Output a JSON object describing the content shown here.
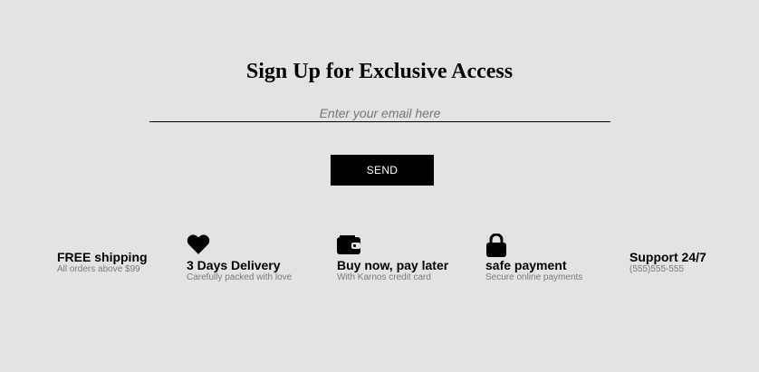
{
  "signup": {
    "heading": "Sign Up for Exclusive Access",
    "email_placeholder": "Enter your email here",
    "send_label": "SEND"
  },
  "features": [
    {
      "title": "FREE shipping",
      "subtitle": "All orders above $99",
      "icon": ""
    },
    {
      "title": "3 Days Delivery",
      "subtitle": "Carefully packed with love",
      "icon": "heart-icon"
    },
    {
      "title": "Buy now, pay later",
      "subtitle": "With Karnos credit card",
      "icon": "wallet-icon"
    },
    {
      "title": "safe payment",
      "subtitle": "Secure online payments",
      "icon": "lock-icon"
    },
    {
      "title": "Support 24/7",
      "subtitle": "(555)555-555",
      "icon": ""
    }
  ],
  "colors": {
    "background": "#e3e3e3",
    "button": "#000000",
    "button_text": "#ffffff",
    "subtitle": "#7a7a7a"
  }
}
